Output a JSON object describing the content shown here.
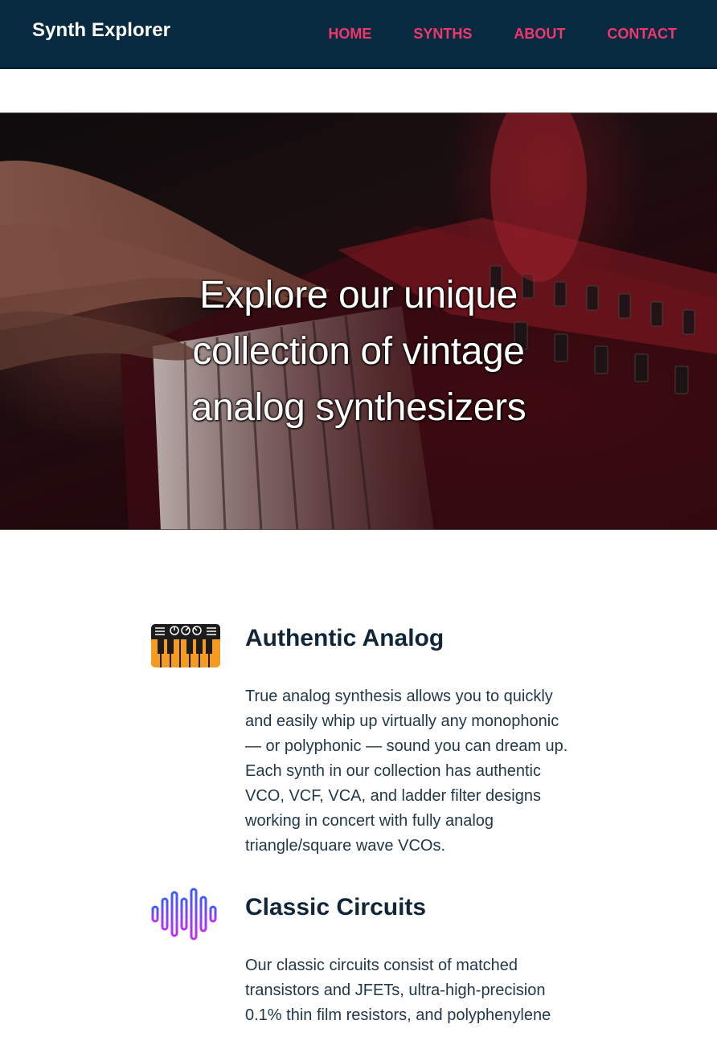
{
  "header": {
    "brand": "Synth Explorer",
    "nav": [
      "HOME",
      "SYNTHS",
      "ABOUT",
      "CONTACT"
    ]
  },
  "hero": {
    "title": "Explore our unique collection of vintage analog synthesizers"
  },
  "features": [
    {
      "icon": "synth-keyboard-icon",
      "title": "Authentic Analog",
      "text": "True analog synthesis allows you to quickly and easily whip up virtually any monophonic — or polyphonic — sound you can dream up. Each synth in our collection has authentic VCO, VCF, VCA, and ladder filter designs working in concert with fully analog triangle/square wave VCOs."
    },
    {
      "icon": "sound-wave-icon",
      "title": "Classic Circuits",
      "text": "Our classic circuits consist of matched transistors and JFETs, ultra-high-precision 0.1% thin film resistors, and polyphenylene"
    }
  ],
  "colors": {
    "navbar": "#082a40",
    "nav_link": "#f0376c",
    "heading": "#102638",
    "body_text": "#22384a",
    "keyboard_icon_orange": "#f59b1f",
    "wave_icon_gradient": [
      "#3b5bff",
      "#c030f0"
    ]
  }
}
